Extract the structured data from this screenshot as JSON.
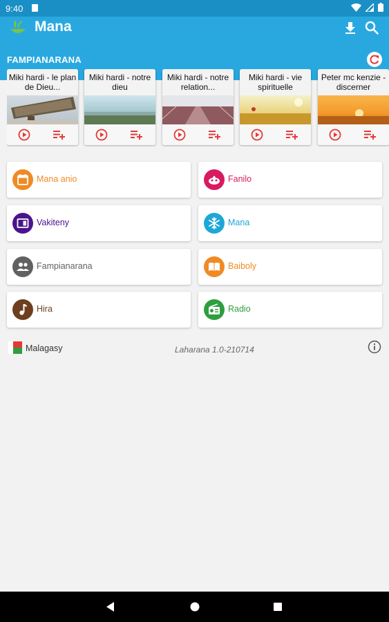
{
  "status_bar": {
    "time": "9:40"
  },
  "app_bar": {
    "title": "Mana",
    "brand_color": "#29a8e0"
  },
  "section": {
    "title": "FAMPIANARANA"
  },
  "teachings": [
    {
      "title": "Miki hardi - le plan de Dieu..."
    },
    {
      "title": "Miki hardi - notre dieu"
    },
    {
      "title": "Miki hardi - notre relation..."
    },
    {
      "title": "Miki hardi - vie spirituelle"
    },
    {
      "title": "Peter mc kenzie - discerner"
    }
  ],
  "menu": [
    {
      "label": "Mana anio",
      "color": "#f08a24",
      "icon": "calendar-icon"
    },
    {
      "label": "Fanilo",
      "color": "#d81b60",
      "icon": "lamp-icon"
    },
    {
      "label": "Vakiteny",
      "color": "#4a148c",
      "icon": "reading-icon"
    },
    {
      "label": "Mana",
      "color": "#1ea7d6",
      "icon": "snowflake-icon"
    },
    {
      "label": "Fampianarana",
      "color": "#616161",
      "icon": "people-icon"
    },
    {
      "label": "Baiboly",
      "color": "#f08a24",
      "icon": "book-icon"
    },
    {
      "label": "Hira",
      "color": "#6d3f1f",
      "icon": "music-note-icon"
    },
    {
      "label": "Radio",
      "color": "#2e9e3e",
      "icon": "radio-icon"
    }
  ],
  "footer": {
    "language": "Malagasy",
    "version": "Laharana 1.0-210714"
  }
}
